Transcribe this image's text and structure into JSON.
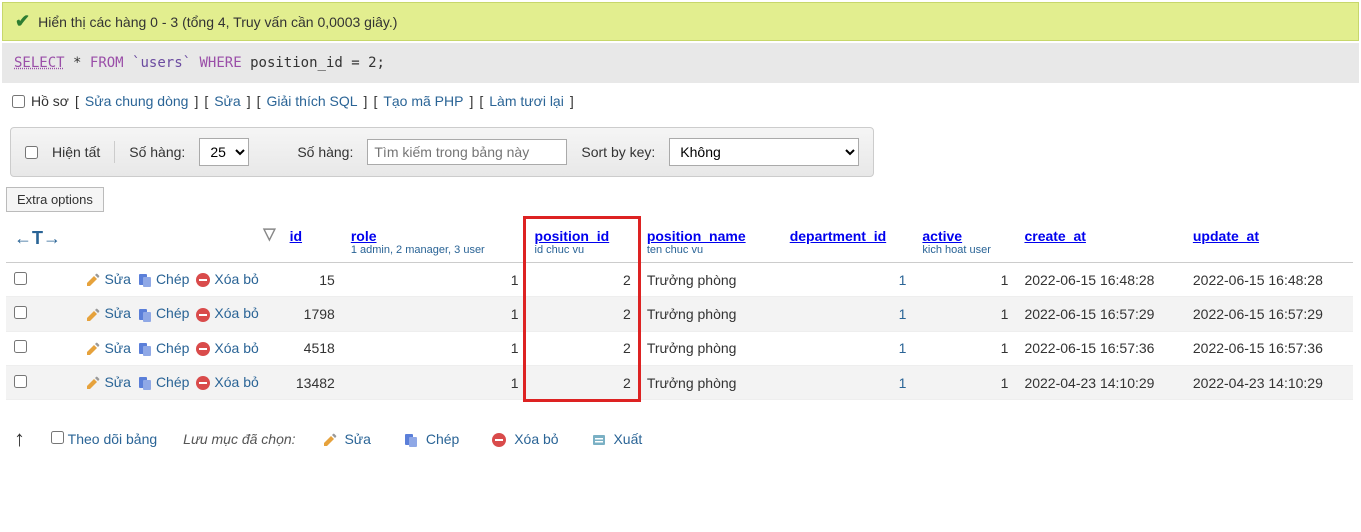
{
  "success": {
    "message": "Hiển thị các hàng 0 - 3 (tổng 4, Truy vấn cần 0,0003 giây.)"
  },
  "sql": {
    "select": "SELECT",
    "star": "*",
    "from": "FROM",
    "table": "`users`",
    "where": "WHERE",
    "condition": "position_id = 2;"
  },
  "actions": {
    "profile": "Hồ sơ",
    "edit_inline": "Sửa chung dòng",
    "edit": "Sửa",
    "explain": "Giải thích SQL",
    "php": "Tạo mã PHP",
    "refresh": "Làm tươi lại"
  },
  "controls": {
    "show_all": "Hiện tất",
    "rows_label": "Số hàng:",
    "rows_value": "25",
    "search_label": "Số hàng:",
    "search_placeholder": "Tìm kiếm trong bảng này",
    "sort_label": "Sort by key:",
    "sort_value": "Không"
  },
  "extra_options": "Extra options",
  "headers": {
    "id": "id",
    "role": "role",
    "role_sub": "1 admin, 2 manager, 3 user",
    "position_id": "position_id",
    "position_id_sub": "id chuc vu",
    "position_name": "position_name",
    "position_name_sub": "ten chuc vu",
    "department_id": "department_id",
    "active": "active",
    "active_sub": "kich hoat user",
    "create_at": "create_at",
    "update_at": "update_at"
  },
  "row_actions": {
    "edit": "Sửa",
    "copy": "Chép",
    "delete": "Xóa bỏ"
  },
  "rows": [
    {
      "id": "15",
      "role": "1",
      "position_id": "2",
      "position_name": "Trưởng phòng",
      "department_id": "1",
      "active": "1",
      "create_at": "2022-06-15 16:48:28",
      "update_at": "2022-06-15 16:48:28"
    },
    {
      "id": "1798",
      "role": "1",
      "position_id": "2",
      "position_name": "Trưởng phòng",
      "department_id": "1",
      "active": "1",
      "create_at": "2022-06-15 16:57:29",
      "update_at": "2022-06-15 16:57:29"
    },
    {
      "id": "4518",
      "role": "1",
      "position_id": "2",
      "position_name": "Trưởng phòng",
      "department_id": "1",
      "active": "1",
      "create_at": "2022-06-15 16:57:36",
      "update_at": "2022-06-15 16:57:36"
    },
    {
      "id": "13482",
      "role": "1",
      "position_id": "2",
      "position_name": "Trưởng phòng",
      "department_id": "1",
      "active": "1",
      "create_at": "2022-04-23 14:10:29",
      "update_at": "2022-04-23 14:10:29"
    }
  ],
  "footer": {
    "track": "Theo dõi bảng",
    "with_selected": "Lưu mục đã chọn:",
    "edit": "Sửa",
    "copy": "Chép",
    "delete": "Xóa bỏ",
    "export": "Xuất"
  }
}
